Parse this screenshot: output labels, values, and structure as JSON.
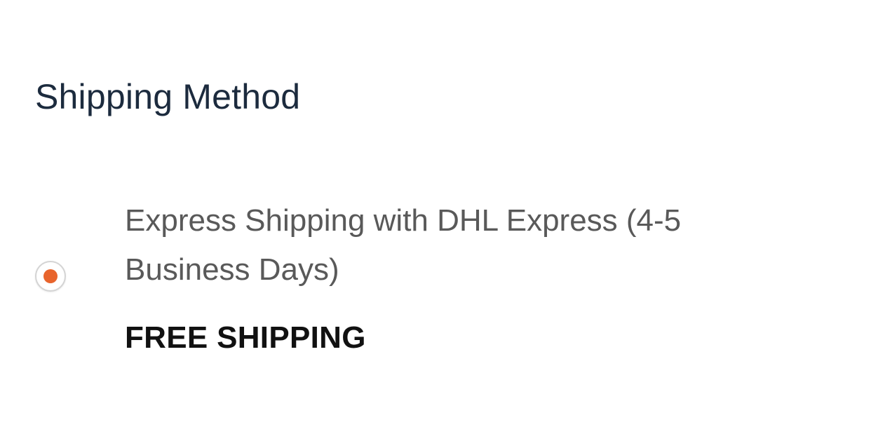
{
  "section": {
    "title": "Shipping Method"
  },
  "shipping_options": [
    {
      "label": "Express Shipping with DHL Express (4-5 Business Days)",
      "price": "FREE SHIPPING",
      "selected": true
    }
  ],
  "colors": {
    "title": "#1c2b3e",
    "label": "#595959",
    "price": "#111111",
    "radio_accent": "#e8642c",
    "radio_border": "#d4d4d4"
  }
}
